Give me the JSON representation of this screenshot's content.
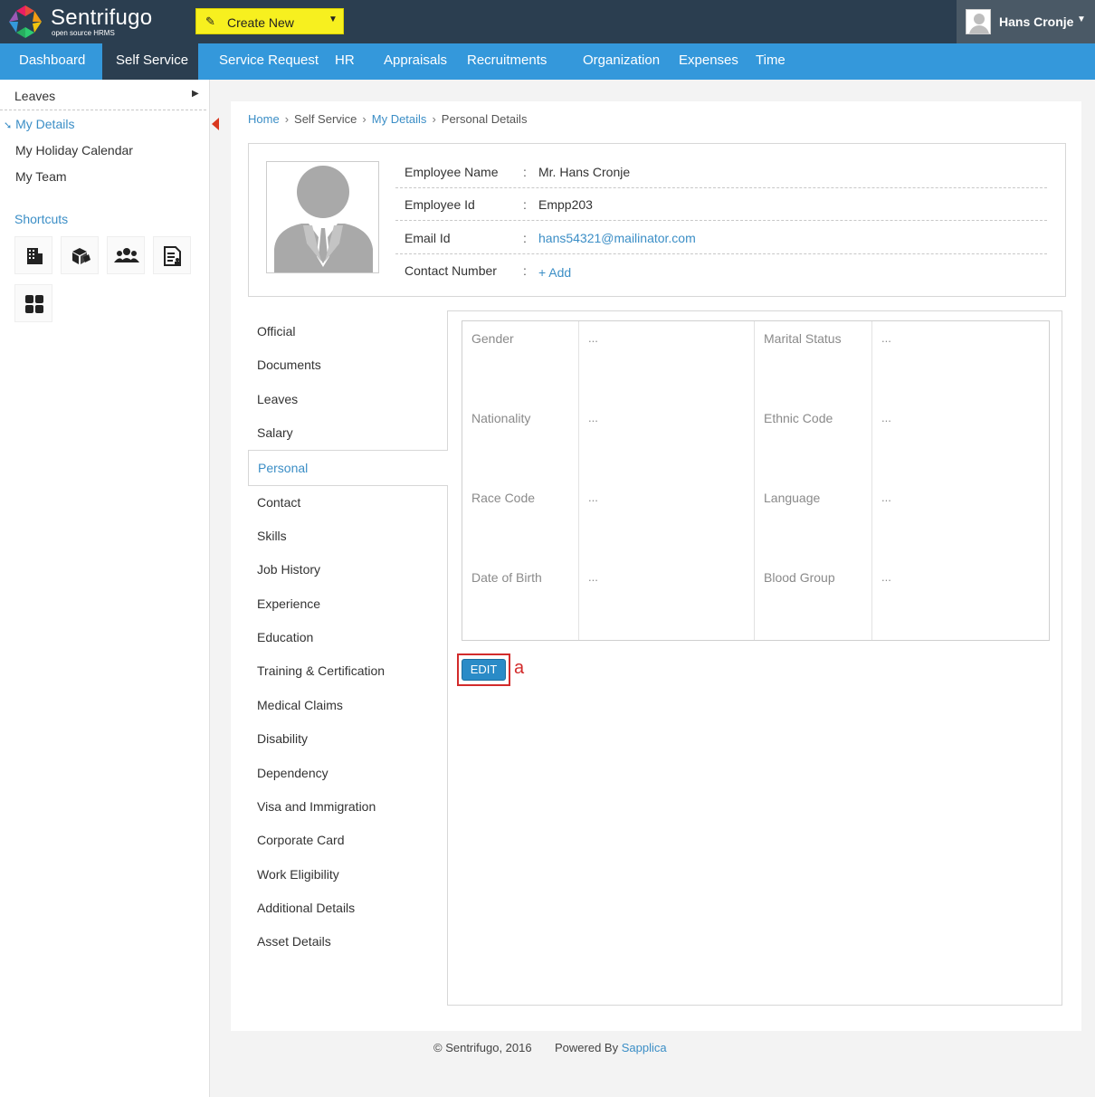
{
  "header": {
    "brand": "Sentrifugo",
    "tagline": "open source HRMS",
    "create_new_label": "Create New",
    "user_name": "Hans Cronje",
    "icons": {
      "logo": "sentrifugo-logo-icon",
      "create": "pencil-icon",
      "caret": "chevron-down-icon",
      "avatar": "user-avatar-icon"
    }
  },
  "nav": {
    "items": [
      {
        "label": "Dashboard"
      },
      {
        "label": "Self Service"
      },
      {
        "label": "Service Request"
      },
      {
        "label": "HR"
      },
      {
        "label": "Appraisals"
      },
      {
        "label": "Recruitments"
      },
      {
        "label": "Organization"
      },
      {
        "label": "Expenses"
      },
      {
        "label": "Time"
      }
    ],
    "active": "Self Service"
  },
  "sidebar": {
    "items": [
      {
        "label": "Leaves"
      },
      {
        "label": "My Details"
      },
      {
        "label": "My Holiday Calendar"
      },
      {
        "label": "My Team"
      }
    ],
    "active": "My Details",
    "shortcuts_title": "Shortcuts",
    "shortcut_icons": [
      "building-icon",
      "boxes-icon",
      "people-icon",
      "document-icon",
      "grid-icon"
    ]
  },
  "breadcrumb": [
    "Home",
    "Self Service",
    "My Details",
    "Personal Details"
  ],
  "employee": {
    "rows": [
      {
        "label": "Employee Name",
        "value": "Mr. Hans Cronje"
      },
      {
        "label": "Employee Id",
        "value": "Empp203"
      },
      {
        "label": "Email Id",
        "value": "hans54321@mailinator.com"
      },
      {
        "label": "Contact Number",
        "value": "+ Add"
      }
    ],
    "separator": ":"
  },
  "tabs": [
    "Official",
    "Documents",
    "Leaves",
    "Salary",
    "Personal",
    "Contact",
    "Skills",
    "Job History",
    "Experience",
    "Education",
    "Training & Certification",
    "Medical Claims",
    "Disability",
    "Dependency",
    "Visa and Immigration",
    "Corporate Card",
    "Work Eligibility",
    "Additional Details",
    "Asset Details"
  ],
  "active_tab": "Personal",
  "personal": {
    "fields": [
      {
        "label": "Gender",
        "value": "..."
      },
      {
        "label": "Marital Status",
        "value": "..."
      },
      {
        "label": "Nationality",
        "value": "..."
      },
      {
        "label": "Ethnic Code",
        "value": "..."
      },
      {
        "label": "Race Code",
        "value": "..."
      },
      {
        "label": "Language",
        "value": "..."
      },
      {
        "label": "Date of Birth",
        "value": "..."
      },
      {
        "label": "Blood Group",
        "value": "..."
      }
    ],
    "edit_label": "EDIT",
    "annotation": "a"
  },
  "footer": {
    "copyright": "© Sentrifugo, 2016",
    "powered_prefix": "Powered By",
    "powered_link": "Sapplica"
  },
  "colors": {
    "topbar": "#2b3e50",
    "nav": "#3498db",
    "create_new": "#f7f01f",
    "link": "#3b8ec6",
    "edit_button": "#2a8bc7",
    "annotation": "#d22b2b"
  }
}
